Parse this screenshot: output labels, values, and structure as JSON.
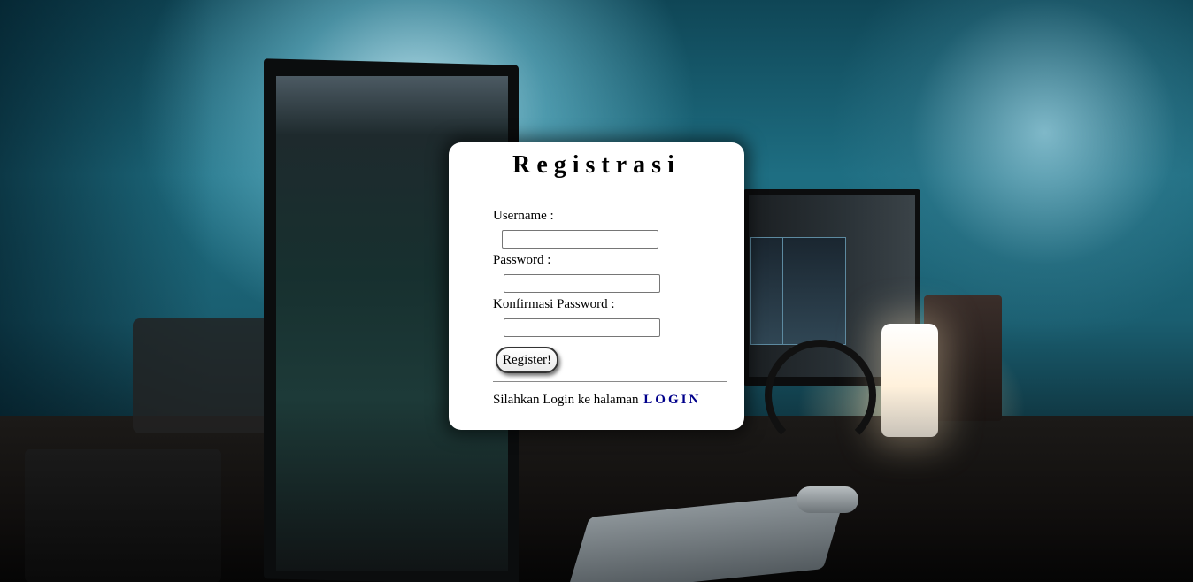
{
  "form": {
    "title": "Registrasi",
    "username_label": "Username :",
    "username_value": "",
    "password_label": "Password :",
    "password_value": "",
    "confirm_label": "Konfirmasi Password :",
    "confirm_value": "",
    "submit_label": "Register!"
  },
  "footer": {
    "text": "Silahkan Login ke halaman",
    "login_link": "LOGIN"
  },
  "colors": {
    "card_background": "#ffffff",
    "link": "#00008b"
  }
}
